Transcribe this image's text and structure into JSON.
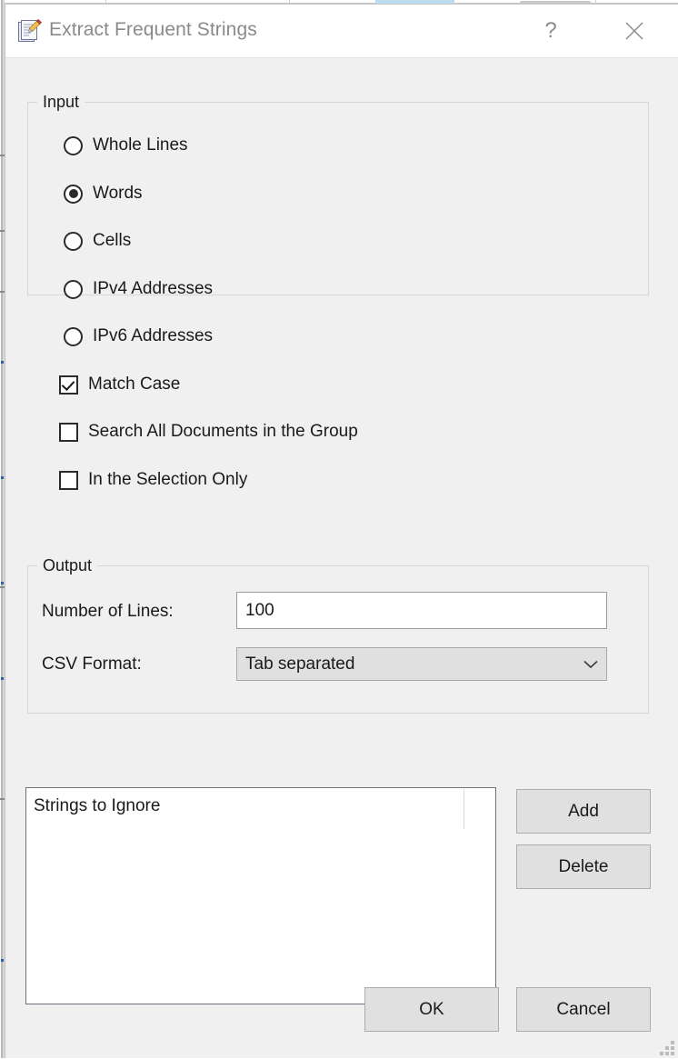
{
  "window": {
    "title": "Extract Frequent Strings",
    "icon": "notepad-pencil-icon",
    "help_label": "?",
    "close_label": "Close",
    "colors": {
      "titlebar_bg": "#ffffff",
      "dialog_bg": "#f0f0f0",
      "title_text": "#8a8a8a",
      "body_text": "#1a1a1a",
      "button_bg": "#e0e0e0",
      "button_border": "#adadad",
      "field_border": "#9a9a9a",
      "listbox_border": "#6c727c",
      "group_border": "#d6d6d6",
      "bg_cell_highlight": "#bcdcf0"
    }
  },
  "input_group": {
    "legend": "Input",
    "radios": [
      {
        "label": "Whole Lines",
        "checked": false,
        "name": "radio-whole-lines"
      },
      {
        "label": "Words",
        "checked": true,
        "name": "radio-words"
      },
      {
        "label": "Cells",
        "checked": false,
        "name": "radio-cells"
      },
      {
        "label": "IPv4 Addresses",
        "checked": false,
        "name": "radio-ipv4-addresses"
      },
      {
        "label": "IPv6 Addresses",
        "checked": false,
        "name": "radio-ipv6-addresses"
      }
    ],
    "checkboxes": [
      {
        "label": "Match Case",
        "checked": true,
        "name": "checkbox-match-case"
      },
      {
        "label": "Search All Documents in the Group",
        "checked": false,
        "name": "checkbox-search-all-documents"
      },
      {
        "label": "In the Selection Only",
        "checked": false,
        "name": "checkbox-in-the-selection-only"
      }
    ]
  },
  "output_group": {
    "legend": "Output",
    "number_of_lines_label": "Number of Lines:",
    "number_of_lines_value": "100",
    "csv_format_label": "CSV Format:",
    "csv_format_value": "Tab separated",
    "csv_format_options": [
      "Tab separated"
    ]
  },
  "ignore_list": {
    "header": "Strings to Ignore",
    "items": []
  },
  "buttons": {
    "add": "Add",
    "delete": "Delete",
    "ok": "OK",
    "cancel": "Cancel"
  }
}
